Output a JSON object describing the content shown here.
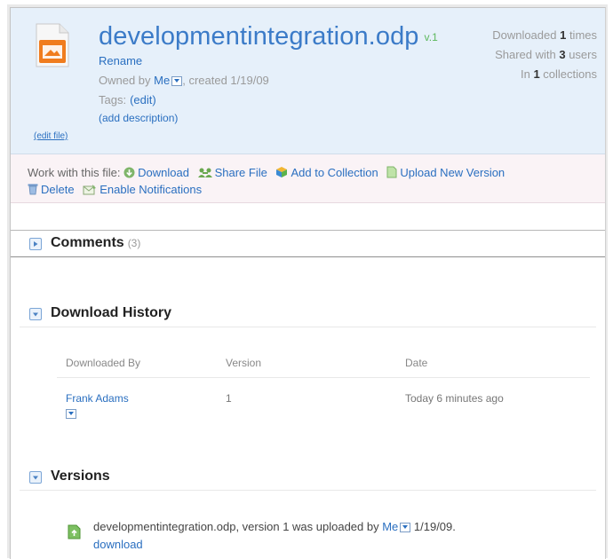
{
  "file": {
    "name": "developmentintegration.odp",
    "version_badge": "v.1",
    "rename_label": "Rename",
    "owned_prefix": "Owned by ",
    "owner": "Me",
    "created_text": ", created 1/19/09",
    "tags_label": "Tags:",
    "tags_edit": "(edit)",
    "add_description": "(add description)",
    "edit_file": "(edit file)"
  },
  "stats": {
    "downloaded_prefix": "Downloaded ",
    "downloaded_count": "1",
    "downloaded_suffix": " times",
    "shared_prefix": "Shared with ",
    "shared_count": "3",
    "shared_suffix": " users",
    "collections_prefix": "In ",
    "collections_count": "1",
    "collections_suffix": " collections"
  },
  "actions": {
    "prefix": "Work with this file:",
    "download": "Download",
    "share": "Share File",
    "add_collection": "Add to Collection",
    "upload_version": "Upload New Version",
    "delete": "Delete",
    "notifications": "Enable Notifications"
  },
  "comments": {
    "label": "Comments",
    "count": "(3)"
  },
  "download_history": {
    "label": "Download History",
    "columns": [
      "Downloaded By",
      "Version",
      "Date"
    ],
    "rows": [
      {
        "user": "Frank Adams",
        "version": "1",
        "date": "Today 6 minutes ago"
      }
    ]
  },
  "versions": {
    "label": "Versions",
    "entry_text": "developmentintegration.odp, version 1 was uploaded by ",
    "entry_user": "Me",
    "entry_date": " 1/19/09.",
    "download_link": "download"
  },
  "colors": {
    "link": "#2a6fc0",
    "title": "#3b7bc8",
    "header_bg": "#e6f0fa",
    "actions_bg": "#faf3f6",
    "version_badge": "#5cb85c"
  }
}
